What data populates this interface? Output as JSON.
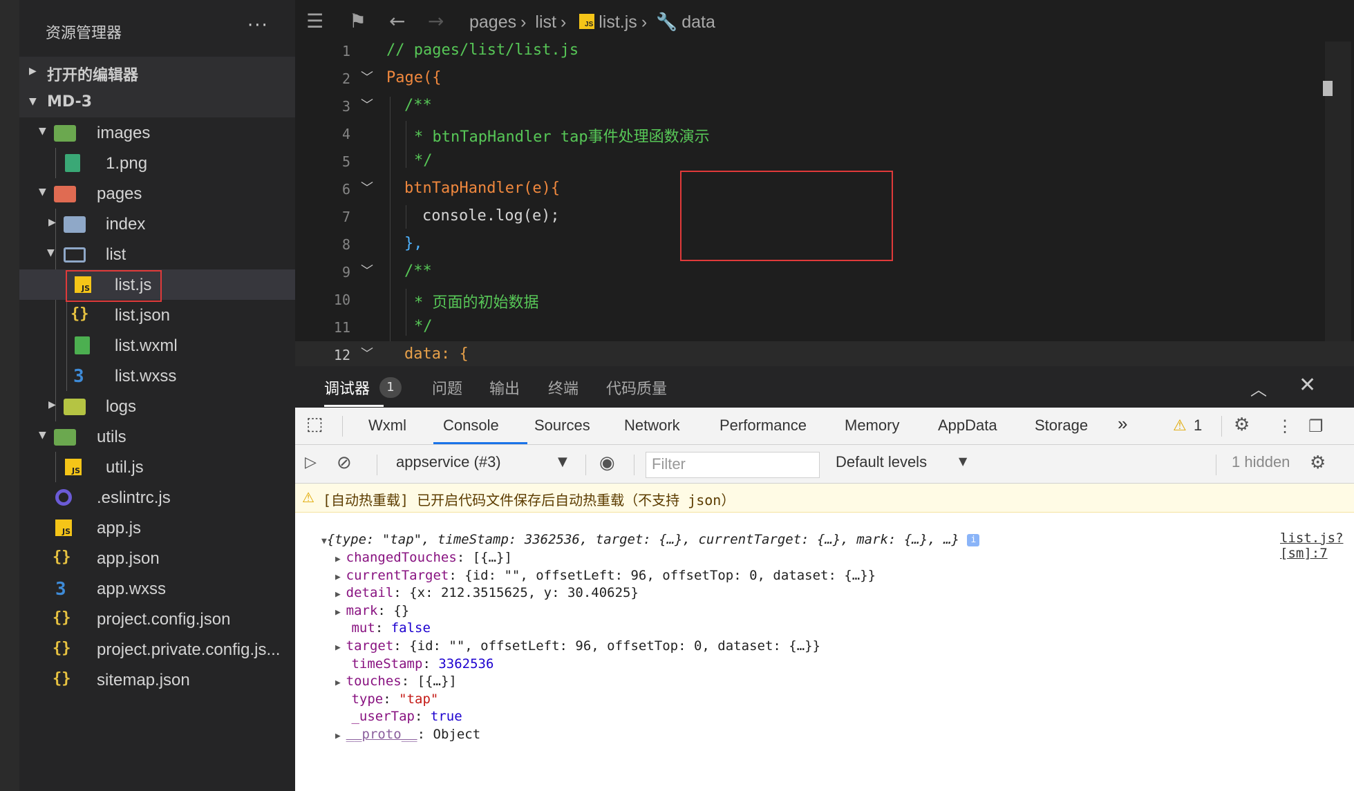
{
  "sidebar": {
    "title": "资源管理器",
    "more": "···",
    "sections": [
      {
        "label": "打开的编辑器",
        "expanded": false
      },
      {
        "label": "MD-3",
        "expanded": true
      }
    ],
    "tree": [
      {
        "label": "images",
        "icon": "folder-green-icon"
      },
      {
        "label": "1.png",
        "icon": "image-file-icon"
      },
      {
        "label": "pages",
        "icon": "folder-red-icon"
      },
      {
        "label": "index",
        "icon": "folder-icon"
      },
      {
        "label": "list",
        "icon": "folder-open-icon"
      },
      {
        "label": "list.js",
        "icon": "js-file-icon"
      },
      {
        "label": "list.json",
        "icon": "json-file-icon"
      },
      {
        "label": "list.wxml",
        "icon": "wxml-file-icon"
      },
      {
        "label": "list.wxss",
        "icon": "css-file-icon"
      },
      {
        "label": "logs",
        "icon": "folder-yellow-icon"
      },
      {
        "label": "utils",
        "icon": "folder-green-icon"
      },
      {
        "label": "util.js",
        "icon": "js-file-icon"
      },
      {
        "label": ".eslintrc.js",
        "icon": "eslint-file-icon"
      },
      {
        "label": "app.js",
        "icon": "js-file-icon"
      },
      {
        "label": "app.json",
        "icon": "json-file-icon"
      },
      {
        "label": "app.wxss",
        "icon": "css-file-icon"
      },
      {
        "label": "project.config.json",
        "icon": "json-file-icon"
      },
      {
        "label": "project.private.config.js...",
        "icon": "json-file-icon"
      },
      {
        "label": "sitemap.json",
        "icon": "json-file-icon"
      }
    ]
  },
  "editor": {
    "breadcrumb": [
      "pages",
      "list",
      "list.js",
      "data"
    ],
    "lines": [
      {
        "n": "1",
        "text": "// pages/list/list.js"
      },
      {
        "n": "2",
        "text": "Page({"
      },
      {
        "n": "3",
        "text": "/**"
      },
      {
        "n": "4",
        "text": "* btnTapHandler tap事件处理函数演示"
      },
      {
        "n": "5",
        "text": "*/"
      },
      {
        "n": "6",
        "text": "btnTapHandler(e){"
      },
      {
        "n": "7",
        "text": "console.log(e);"
      },
      {
        "n": "8",
        "text": "},"
      },
      {
        "n": "9",
        "text": "/**"
      },
      {
        "n": "10",
        "text": "* 页面的初始数据"
      },
      {
        "n": "11",
        "text": "*/"
      },
      {
        "n": "12",
        "text": "data: {"
      }
    ]
  },
  "panel": {
    "tabs": [
      {
        "label": "调试器",
        "badge": "1"
      },
      {
        "label": "问题"
      },
      {
        "label": "输出"
      },
      {
        "label": "终端"
      },
      {
        "label": "代码质量"
      }
    ]
  },
  "devtools": {
    "tabs": [
      "Wxml",
      "Console",
      "Sources",
      "Network",
      "Performance",
      "Memory",
      "AppData",
      "Storage"
    ],
    "more": "»",
    "warning_count": "1",
    "context": "appservice (#3)",
    "filter_placeholder": "Filter",
    "levels": "Default levels",
    "hidden": "1 hidden"
  },
  "console": {
    "warning": "[自动热重载] 已开启代码文件保存后自动热重载（不支持 json）",
    "source": "list.js? [sm]:7",
    "summary": "{type: \"tap\", timeStamp: 3362536, target: {…}, currentTarget: {…}, mark: {…}, …}",
    "props": [
      {
        "key": "changedTouches",
        "value": "[{…}]",
        "expandable": true
      },
      {
        "key": "currentTarget",
        "value": "{id: \"\", offsetLeft: 96, offsetTop: 0, dataset: {…}}",
        "expandable": true
      },
      {
        "key": "detail",
        "value": "{x: 212.3515625, y: 30.40625}",
        "expandable": true
      },
      {
        "key": "mark",
        "value": "{}",
        "expandable": true
      },
      {
        "key": "mut",
        "value": "false",
        "expandable": false
      },
      {
        "key": "target",
        "value": "{id: \"\", offsetLeft: 96, offsetTop: 0, dataset: {…}}",
        "expandable": true
      },
      {
        "key": "timeStamp",
        "value": "3362536",
        "expandable": false
      },
      {
        "key": "touches",
        "value": "[{…}]",
        "expandable": true
      },
      {
        "key": "type",
        "value": "\"tap\"",
        "expandable": false
      },
      {
        "key": "_userTap",
        "value": "true",
        "expandable": false
      },
      {
        "key": "__proto__",
        "value": "Object",
        "expandable": true
      }
    ]
  },
  "colors": {
    "sidebar_bg": "#252526",
    "editor_bg": "#1e1e1e",
    "highlight_border": "#e03a3a",
    "console_accent": "#1a73e8"
  }
}
